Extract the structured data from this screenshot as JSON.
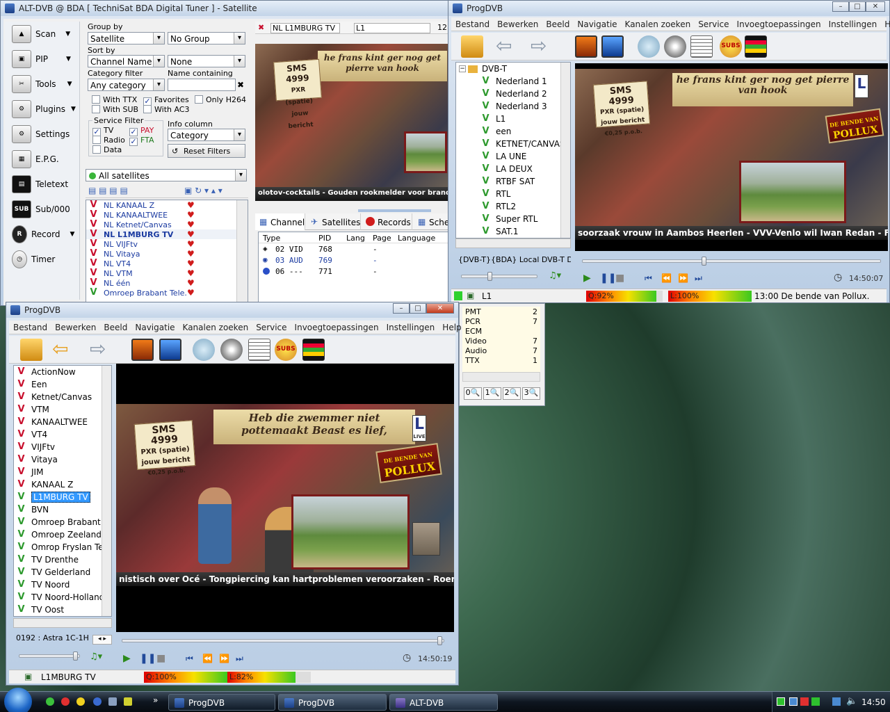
{
  "altdvb": {
    "title": "ALT-DVB @ BDA [ TechniSat BDA Digital Tuner ] - Satellite",
    "side_buttons": [
      "Scan",
      "PIP",
      "Tools",
      "Plugins",
      "Settings",
      "E.P.G.",
      "Teletext",
      "Sub/000",
      "Record",
      "Timer"
    ],
    "group_by_label": "Group by",
    "group_by_value": "Satellite",
    "group_value2": "No Group",
    "sort_by_label": "Sort by",
    "sort_by_value": "Channel Name",
    "sort_value2": "None",
    "category_filter_label": "Category filter",
    "category_value": "Any category",
    "name_containing_label": "Name containing",
    "with_ttx": "With TTX",
    "favorites": "Favorites",
    "only_h264": "Only H264",
    "with_sub": "With SUB",
    "with_ac3": "With AC3",
    "service_filter_label": "Service Filter",
    "tv": "TV",
    "pay": "PAY",
    "radio": "Radio",
    "fta": "FTA",
    "data": "Data",
    "info_column_label": "Info column",
    "info_column_value": "Category",
    "reset_filters": "Reset Filters",
    "satellite_combo": "All satellites",
    "channels": [
      "NL KANAAL Z",
      "NL KANAALTWEE",
      "NL Ketnet/Canvas",
      "NL L1MBURG TV",
      "NL VIJFtv",
      "NL Vitaya",
      "NL VT4",
      "NL VTM",
      "NL één",
      "Omroep Brabant Tele..."
    ],
    "current_channel": "NL L1MBURG TV",
    "current_channel_short": "L1",
    "current_channel_num": "12",
    "ticker_text": "olotov-cocktails  -  Gouden rookmelder voor brandweer",
    "tabs": [
      "Channel",
      "Satellites",
      "Records",
      "Sche"
    ],
    "pid_headers": [
      "Type",
      "PID",
      "Lang",
      "Page",
      "Language"
    ],
    "pid_rows": [
      {
        "type": "02 VID",
        "pid": "768",
        "lang": "-"
      },
      {
        "type": "03 AUD",
        "pid": "769",
        "lang": "-"
      },
      {
        "type": "06 ---",
        "pid": "771",
        "lang": "-"
      }
    ]
  },
  "info_panel": {
    "rows": [
      {
        "label": "PMT",
        "value": "2"
      },
      {
        "label": "PCR",
        "value": "7"
      },
      {
        "label": "ECM",
        "value": ""
      },
      {
        "label": "Video",
        "value": "7"
      },
      {
        "label": "Audio",
        "value": "7"
      },
      {
        "label": "TTX",
        "value": "1"
      }
    ],
    "zoom_buttons": [
      "0",
      "1",
      "2",
      "3"
    ]
  },
  "progdvb_top": {
    "title": "ProgDVB",
    "menu": [
      "Bestand",
      "Bewerken",
      "Beeld",
      "Navigatie",
      "Kanalen zoeken",
      "Service",
      "Invoegtoepassingen",
      "Instellingen",
      "Help"
    ],
    "tree_root": "DVB-T",
    "channels": [
      "Nederland 1",
      "Nederland 2",
      "Nederland 3",
      "L1",
      "een",
      "KETNET/CANVAS",
      "LA UNE",
      "LA DEUX",
      "RTBF SAT",
      "RTL",
      "RTL2",
      "Super RTL",
      "SAT.1"
    ],
    "source": "{DVB-T}{BDA} Local DVB-T Digital",
    "sms_line1": "SMS 4999",
    "sms_line2": "PXR (spatie)",
    "sms_line3": "jouw bericht",
    "sms_line4": "€0,25 p.o.b.",
    "banner": "he frans kint ger nog get pierre van hook",
    "pollux_top": "DE BENDE VAN",
    "pollux": "POLLUX",
    "ticker_text": "soorzaak vrouw in Aambos Heerlen  -  VVV-Venlo wil Iwan Redan  -  Fortuna wil C",
    "time": "14:50:07",
    "status_channel": "L1",
    "quality": "Q:92%",
    "quality_value": 92,
    "level": "L:100%",
    "level_value": 100,
    "epg": "13:00  De bende van Pollux."
  },
  "progdvb_main": {
    "title": "ProgDVB",
    "menu": [
      "Bestand",
      "Bewerken",
      "Beeld",
      "Navigatie",
      "Kanalen zoeken",
      "Service",
      "Invoegtoepassingen",
      "Instellingen",
      "Help"
    ],
    "channels": [
      {
        "name": "ActionNow",
        "mark": "red"
      },
      {
        "name": "Een",
        "mark": "red"
      },
      {
        "name": "Ketnet/Canvas",
        "mark": "red"
      },
      {
        "name": "VTM",
        "mark": "red"
      },
      {
        "name": "KANAALTWEE",
        "mark": "red"
      },
      {
        "name": "VT4",
        "mark": "red"
      },
      {
        "name": "VIJFtv",
        "mark": "red"
      },
      {
        "name": "Vitaya",
        "mark": "red"
      },
      {
        "name": "JIM",
        "mark": "red"
      },
      {
        "name": "KANAAL Z",
        "mark": "red"
      },
      {
        "name": "L1MBURG TV",
        "mark": "grn"
      },
      {
        "name": "BVN",
        "mark": "grn"
      },
      {
        "name": "Omroep Brabant T",
        "mark": "grn"
      },
      {
        "name": "Omroep Zeeland T",
        "mark": "grn"
      },
      {
        "name": "Omrop Fryslan Tel",
        "mark": "grn"
      },
      {
        "name": "TV Drenthe",
        "mark": "grn"
      },
      {
        "name": "TV Gelderland",
        "mark": "grn"
      },
      {
        "name": "TV Noord",
        "mark": "grn"
      },
      {
        "name": "TV Noord-Holland",
        "mark": "grn"
      },
      {
        "name": "TV Oost",
        "mark": "grn"
      }
    ],
    "selected_channel": "L1MBURG TV",
    "source": "0192 : Astra 1C-1H",
    "sms_line1": "SMS 4999",
    "sms_line2": "PXR (spatie)",
    "sms_line3": "jouw bericht",
    "sms_line4": "€0,25 p.o.b.",
    "banner": "Heb die zwemmer niet pottemaakt Beast es lief,",
    "pollux_top": "DE BENDE VAN",
    "pollux": "POLLUX",
    "live": "LIVE",
    "ticker_text": "nistisch over Océ  -  Tongpiercing kan hartproblemen veroorzaken  -  Roermond wil o",
    "time": "14:50:19",
    "status_channel": "L1MBURG TV",
    "quality": "Q:100%",
    "quality_value": 100,
    "level": "L:82%",
    "level_value": 82
  },
  "taskbar": {
    "tasks": [
      "ProgDVB",
      "ProgDVB",
      "ALT-DVB"
    ],
    "clock": "14:50"
  }
}
